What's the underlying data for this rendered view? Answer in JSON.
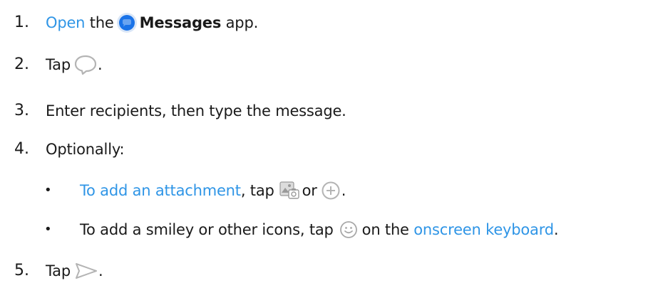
{
  "steps": [
    {
      "number": "1.",
      "link": "Open",
      "text_a": "the",
      "app_name": "Messages",
      "text_b": "app."
    },
    {
      "number": "2.",
      "text": "Tap",
      "end": "."
    },
    {
      "number": "3.",
      "text": "Enter recipients, then type the message."
    },
    {
      "number": "4.",
      "text": "Optionally:"
    },
    {
      "number": "5.",
      "text": "Tap",
      "end": "."
    }
  ],
  "sub_items": [
    {
      "bullet": "•",
      "link": "To add an attachment",
      "text_a": ", tap",
      "text_b": "or",
      "end": "."
    },
    {
      "bullet": "•",
      "text_a": "To add a smiley or other icons, tap",
      "text_b": "on the",
      "link": "onscreen keyboard",
      "end": "."
    }
  ],
  "icons": {
    "messages_app": "messages-app-icon",
    "new_chat": "new-chat-bubble-icon",
    "gallery": "gallery-icon",
    "add": "add-circle-icon",
    "emoji": "emoji-icon",
    "send": "send-icon"
  },
  "colors": {
    "link": "#2f95e6",
    "app_icon": "#1a73e8",
    "icon_gray": "#b4b4b4"
  }
}
